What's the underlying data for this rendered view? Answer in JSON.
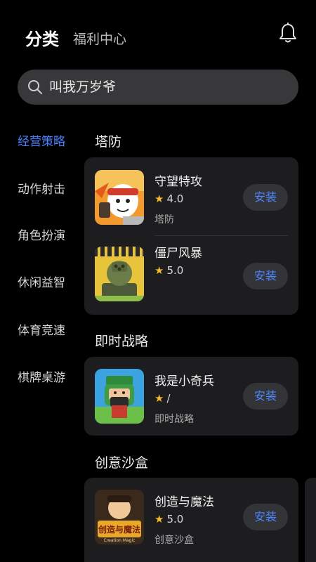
{
  "header": {
    "tab_category": "分类",
    "tab_welfare": "福利中心"
  },
  "search": {
    "placeholder": "叫我万岁爷"
  },
  "sidebar": {
    "items": [
      {
        "label": "经营策略",
        "active": true
      },
      {
        "label": "动作射击",
        "active": false
      },
      {
        "label": "角色扮演",
        "active": false
      },
      {
        "label": "休闲益智",
        "active": false
      },
      {
        "label": "体育竞速",
        "active": false
      },
      {
        "label": "棋牌桌游",
        "active": false
      }
    ]
  },
  "sections": [
    {
      "title": "塔防",
      "apps": [
        {
          "name": "守望特攻",
          "rating": "4.0",
          "category": "塔防",
          "install": "安装",
          "icon": "cartoon-character-icon"
        },
        {
          "name": "僵尸风暴",
          "rating": "5.0",
          "category": "",
          "install": "安装",
          "icon": "turret-icon"
        }
      ]
    },
    {
      "title": "即时战略",
      "apps": [
        {
          "name": "我是小奇兵",
          "rating": "/",
          "category": "即时战略",
          "install": "安装",
          "icon": "warrior-icon"
        }
      ]
    },
    {
      "title": "创意沙盒",
      "apps": [
        {
          "name": "创造与魔法",
          "rating": "5.0",
          "category": "创意沙盒",
          "install": "安装",
          "icon": "creation-magic-icon",
          "icon_text": "创造与魔法",
          "icon_subtext": "Creation Magic"
        }
      ]
    }
  ],
  "colors": {
    "background": "#000000",
    "accent": "#4a82ff",
    "card": "#1d1d1f",
    "star": "#f5b82e"
  }
}
